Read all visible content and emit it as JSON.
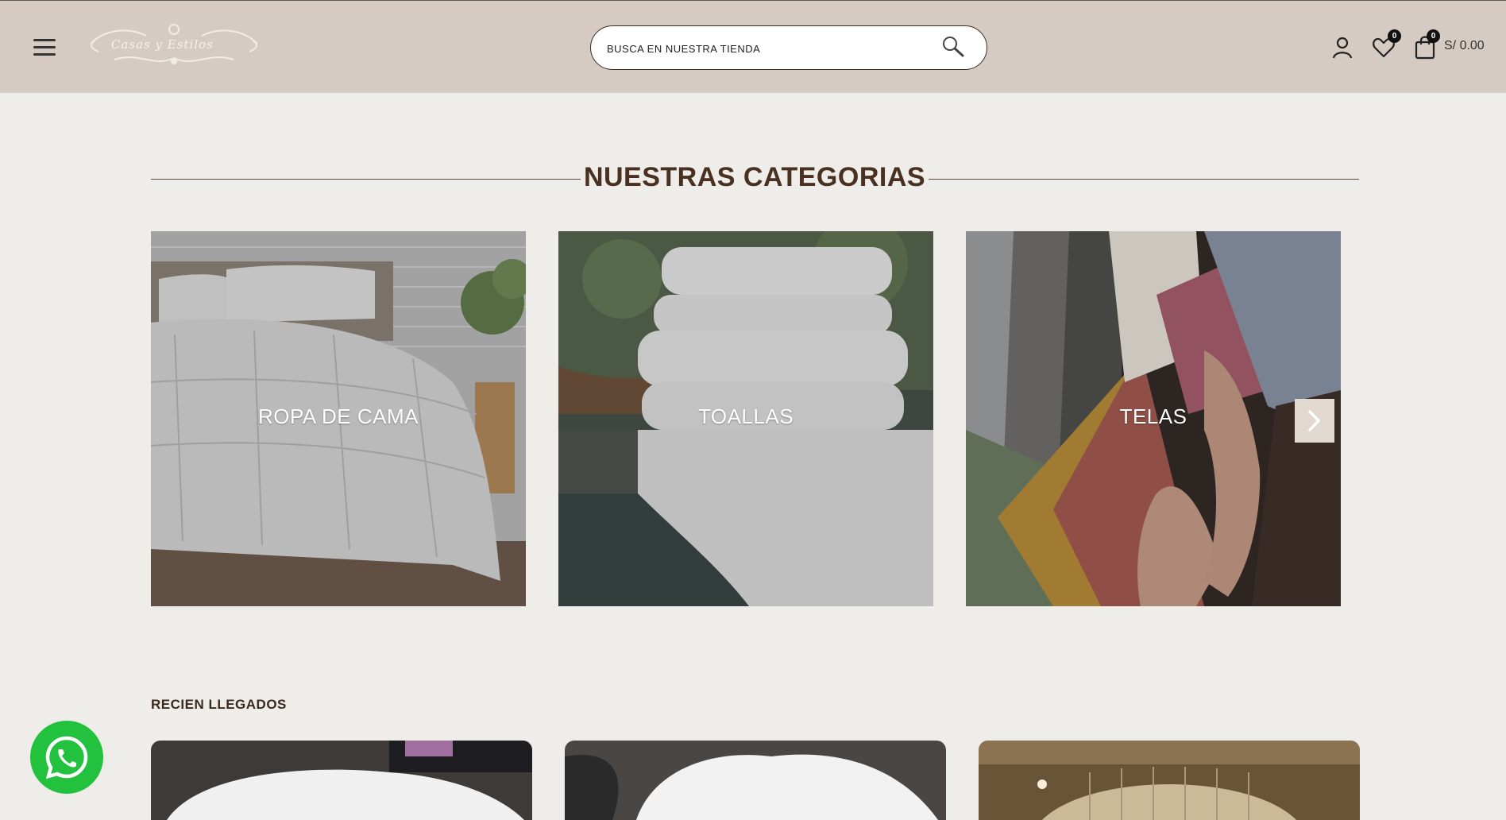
{
  "header": {
    "logo_text": "Casas y Estilos",
    "search_placeholder": "BUSCA EN NUESTRA TIENDA",
    "wishlist_count": "0",
    "cart_count": "0",
    "cart_total": "S/ 0.00"
  },
  "categories": {
    "title": "NUESTRAS CATEGORIAS",
    "items": [
      {
        "label": "ROPA DE CAMA"
      },
      {
        "label": "TOALLAS"
      },
      {
        "label": "TELAS"
      }
    ]
  },
  "recent": {
    "title": "RECIEN LLEGADOS"
  },
  "colors": {
    "header_bg": "#d5cbc2",
    "page_bg": "#efedea",
    "accent_text": "#4a3020",
    "whatsapp": "#22c13e"
  },
  "icons": [
    "menu-icon",
    "search-icon",
    "user-icon",
    "heart-icon",
    "cart-icon",
    "chevron-right-icon",
    "whatsapp-icon"
  ]
}
